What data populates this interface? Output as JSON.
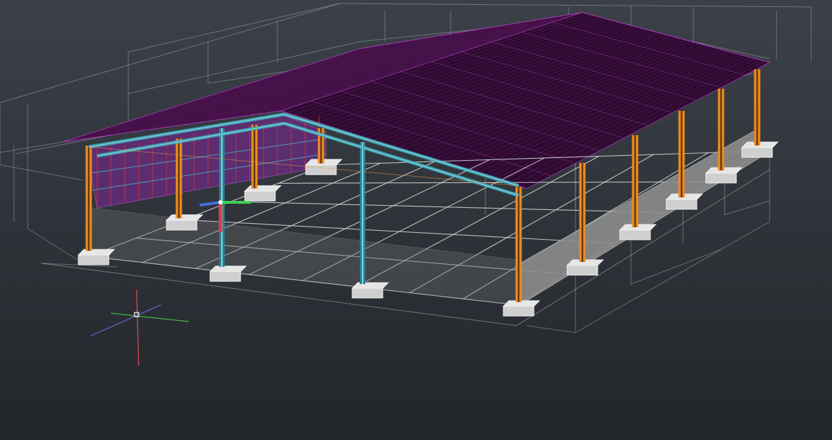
{
  "viewport": {
    "background_top": "#3c4148",
    "background_bottom": "#22262b"
  },
  "colors": {
    "grid": "#d9dde0",
    "roof": "#3c0a3e",
    "roof_edge": "#b040c0",
    "rafter": "#3fa8b8",
    "column": "#f08a1c",
    "column_core": "#5a3a1a",
    "wall": "#8c8c8c",
    "footing": "#cfcfcf",
    "wall_sheet": "#6a2a80",
    "girt": "#e03030",
    "ucs_x": "#e05050",
    "ucs_y": "#40c040",
    "ucs_z": "#6070e0",
    "gizmo_x": "#d94040",
    "gizmo_y": "#40d050",
    "gizmo_z": "#4070e0"
  },
  "icons": {
    "ucs": "crosshair-ucs-icon",
    "gizmo": "move-gizmo-icon"
  }
}
